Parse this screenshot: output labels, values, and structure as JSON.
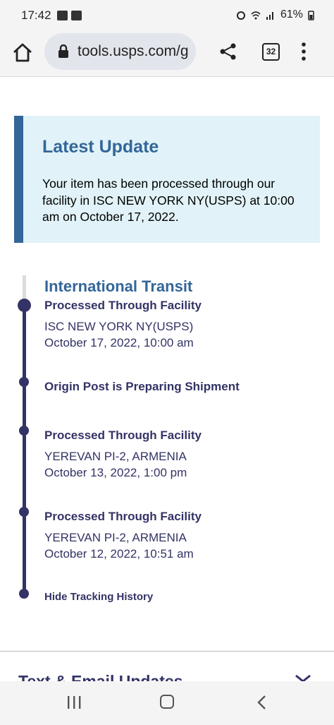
{
  "status_bar": {
    "time": "17:42",
    "battery": "61%"
  },
  "browser": {
    "url": "tools.usps.com/g",
    "tab_count": "32"
  },
  "latest_update": {
    "heading": "Latest Update",
    "body": "Your item has been processed through our facility in ISC NEW YORK NY(USPS) at 10:00 am on October 17, 2022."
  },
  "tracking": {
    "section_title": "International Transit",
    "events": [
      {
        "title": "Processed Through Facility",
        "location": "ISC NEW YORK NY(USPS)",
        "datetime": "October 17, 2022, 10:00 am"
      },
      {
        "title": "Origin Post is Preparing Shipment"
      },
      {
        "title": "Processed Through Facility",
        "location": "YEREVAN PI-2, ARMENIA",
        "datetime": "October 13, 2022, 1:00 pm"
      },
      {
        "title": "Processed Through Facility",
        "location": "YEREVAN PI-2, ARMENIA",
        "datetime": "October 12, 2022, 10:51 am"
      }
    ],
    "hide_link": "Hide Tracking History"
  },
  "next_section": {
    "title": "Text & Email Updates"
  },
  "icons": {
    "home": "home-icon",
    "lock": "lock-icon",
    "share": "share-icon",
    "tabs": "tab-switcher-icon",
    "more": "more-vert-icon",
    "nav_recent": "recent-apps-icon",
    "nav_home": "nav-home-icon",
    "nav_back": "nav-back-icon"
  },
  "colors": {
    "usps_blue": "#336699",
    "usps_navy": "#333366",
    "update_bg": "#e1f3f8"
  }
}
